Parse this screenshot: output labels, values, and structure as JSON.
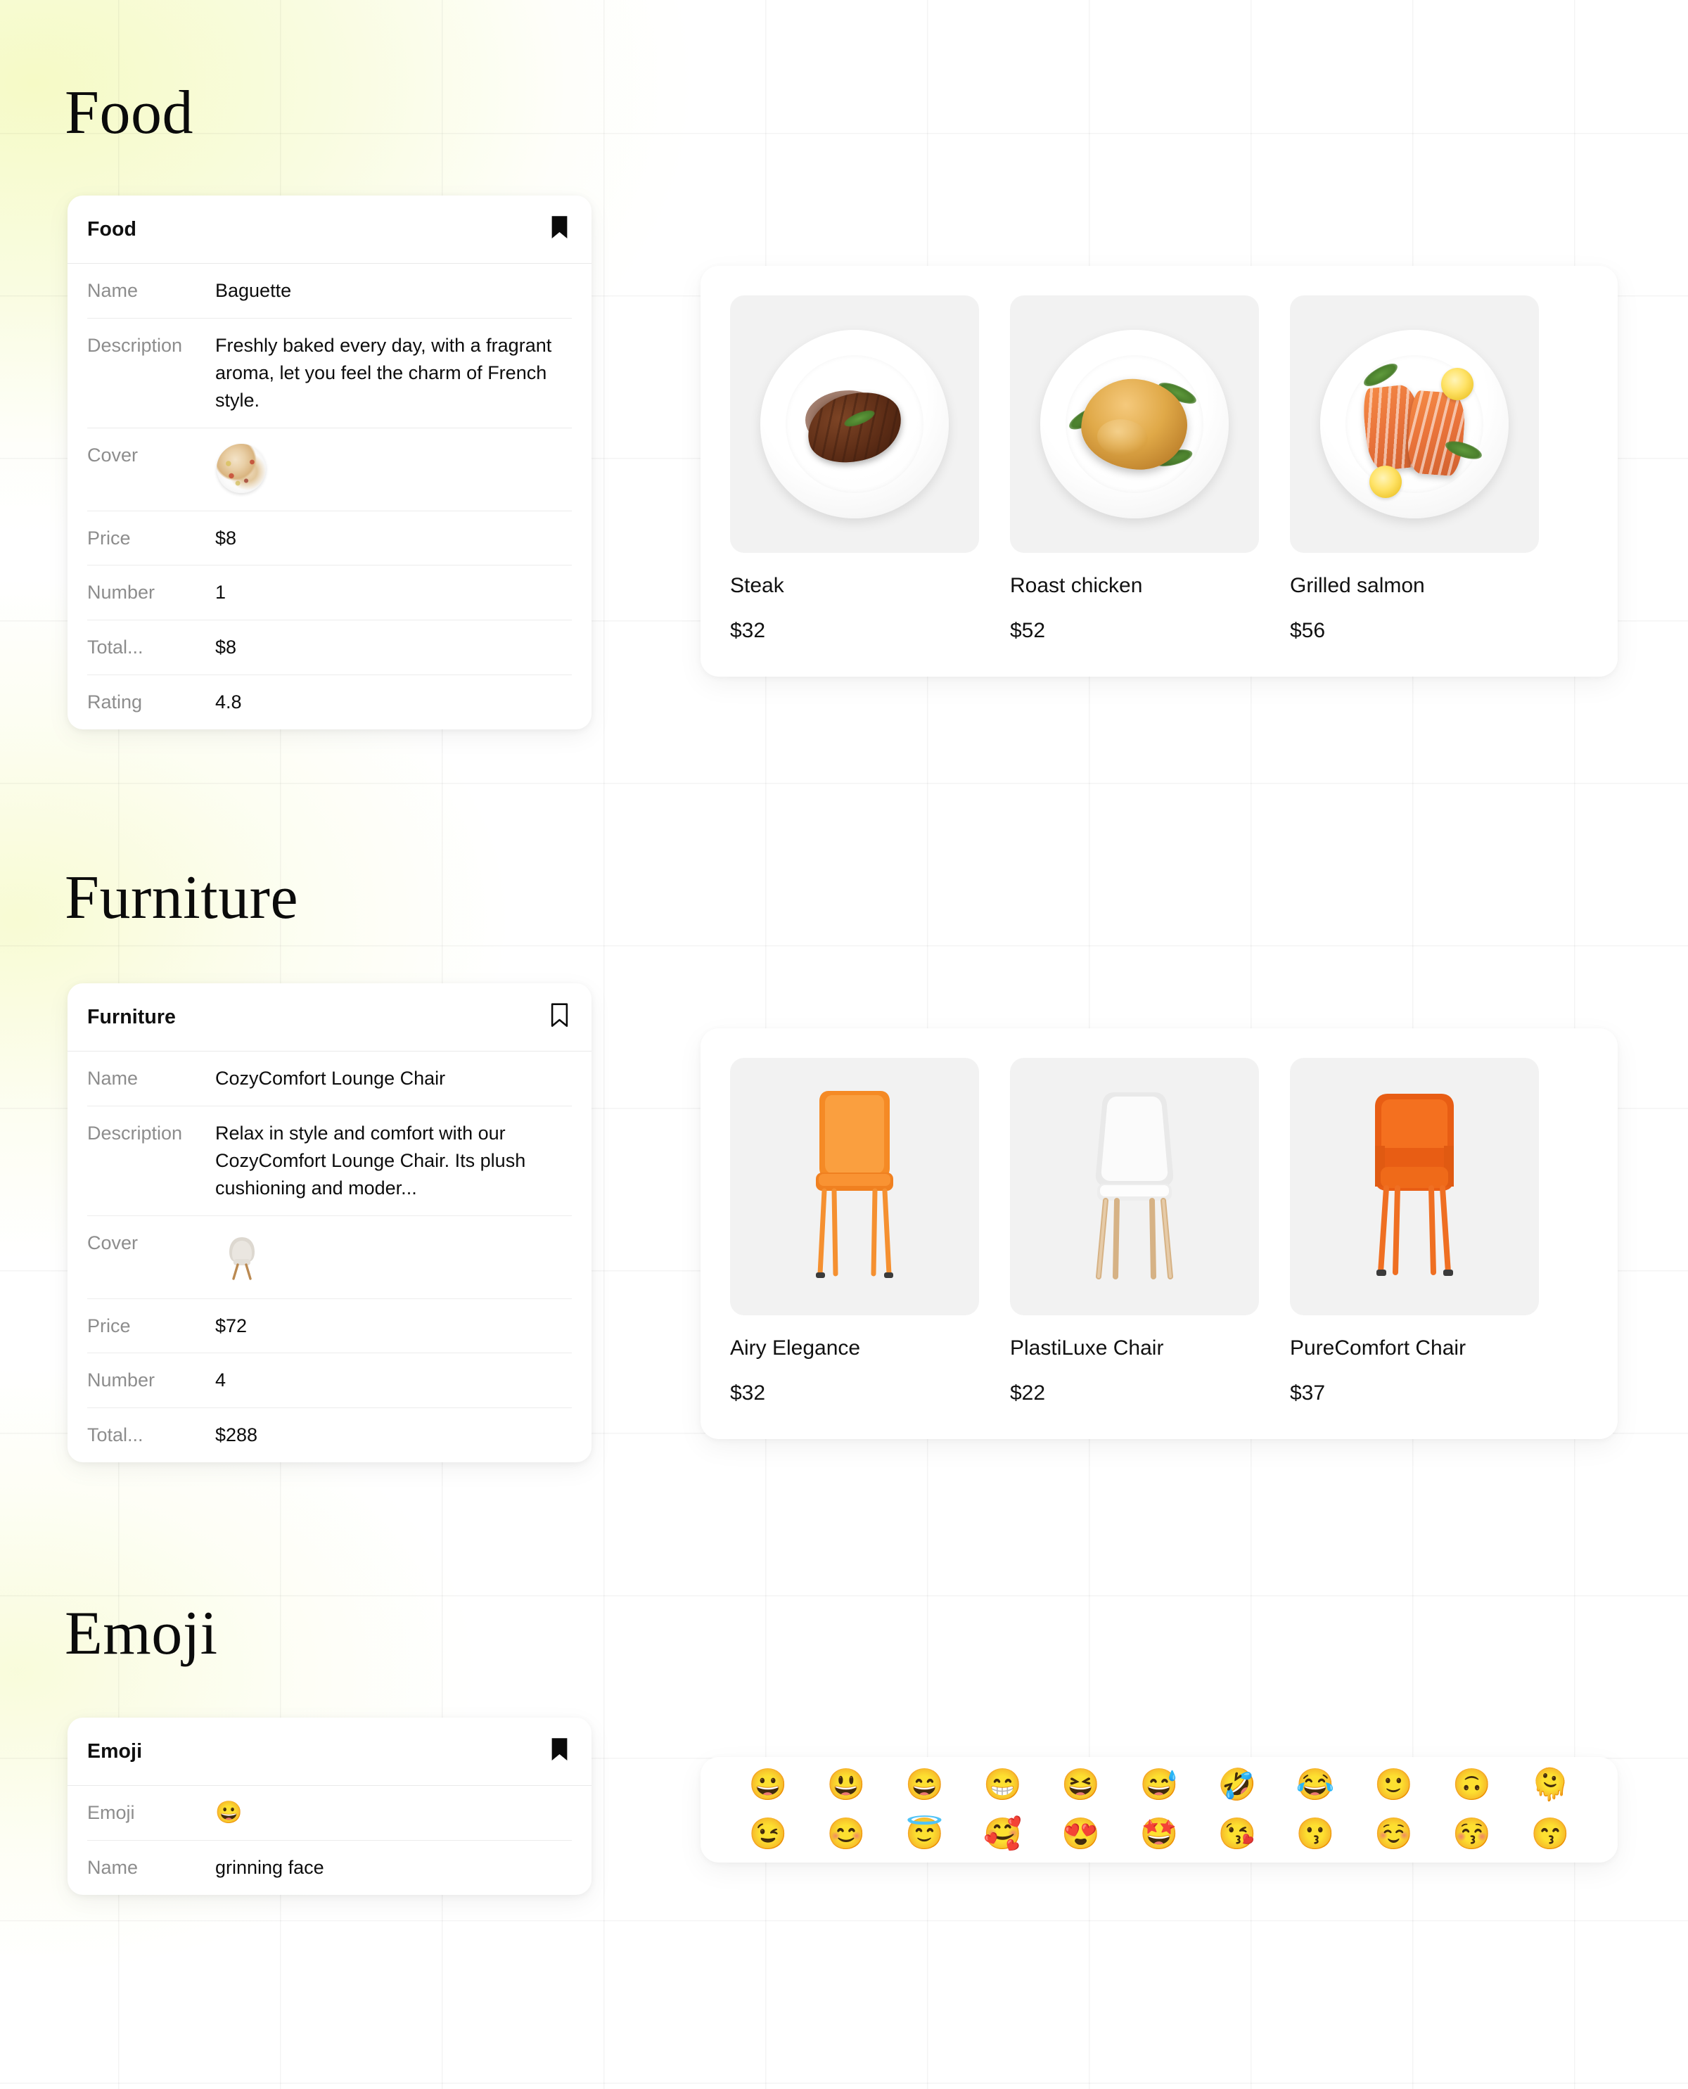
{
  "sections": [
    {
      "heading": "Food",
      "card": {
        "title": "Food",
        "bookmark_icon": "bookmark-filled-icon",
        "rows": [
          {
            "key": "Name",
            "value": "Baguette"
          },
          {
            "key": "Description",
            "value": "Freshly baked every day, with a fragrant aroma, let you feel the charm of French style."
          },
          {
            "key": "Cover",
            "value": ""
          },
          {
            "key": "Price",
            "value": "$8"
          },
          {
            "key": "Number",
            "value": "1"
          },
          {
            "key": "Total...",
            "value": "$8"
          },
          {
            "key": "Rating",
            "value": "4.8"
          }
        ]
      },
      "products": [
        {
          "name": "Steak",
          "price": "$32",
          "image": "steak-plate-image"
        },
        {
          "name": "Roast chicken",
          "price": "$52",
          "image": "roast-chicken-plate-image"
        },
        {
          "name": "Grilled salmon",
          "price": "$56",
          "image": "grilled-salmon-plate-image"
        }
      ]
    },
    {
      "heading": "Furniture",
      "card": {
        "title": "Furniture",
        "bookmark_icon": "bookmark-outline-icon",
        "rows": [
          {
            "key": "Name",
            "value": "CozyComfort Lounge Chair"
          },
          {
            "key": "Description",
            "value": "Relax in style and comfort with our CozyComfort Lounge Chair. Its plush cushioning and moder..."
          },
          {
            "key": "Cover",
            "value": ""
          },
          {
            "key": "Price",
            "value": "$72"
          },
          {
            "key": "Number",
            "value": "4"
          },
          {
            "key": "Total...",
            "value": "$288"
          }
        ]
      },
      "products": [
        {
          "name": "Airy Elegance",
          "price": "$32",
          "image": "orange-side-chair-image"
        },
        {
          "name": "PlastiLuxe Chair",
          "price": "$22",
          "image": "white-wood-leg-chair-image"
        },
        {
          "name": "PureComfort Chair",
          "price": "$37",
          "image": "orange-armchair-image"
        }
      ]
    },
    {
      "heading": "Emoji",
      "card": {
        "title": "Emoji",
        "bookmark_icon": "bookmark-filled-icon",
        "rows": [
          {
            "key": "Emoji",
            "value": "😀"
          },
          {
            "key": "Name",
            "value": "grinning face"
          }
        ]
      },
      "emoji_grid": [
        [
          "😀",
          "😃",
          "😄",
          "😁",
          "😆",
          "😅",
          "🤣",
          "😂",
          "🙂",
          "🙃",
          "🫠"
        ],
        [
          "😉",
          "😊",
          "😇",
          "🥰",
          "😍",
          "🤩",
          "😘",
          "😗",
          "☺️",
          "😚",
          "😙"
        ]
      ]
    }
  ],
  "colors": {
    "background_wash": "#f7fbd6",
    "card_surface": "#ffffff",
    "image_tile": "#f2f2f2",
    "key_text": "#8d8d8d",
    "value_text": "#0d0d0d"
  }
}
